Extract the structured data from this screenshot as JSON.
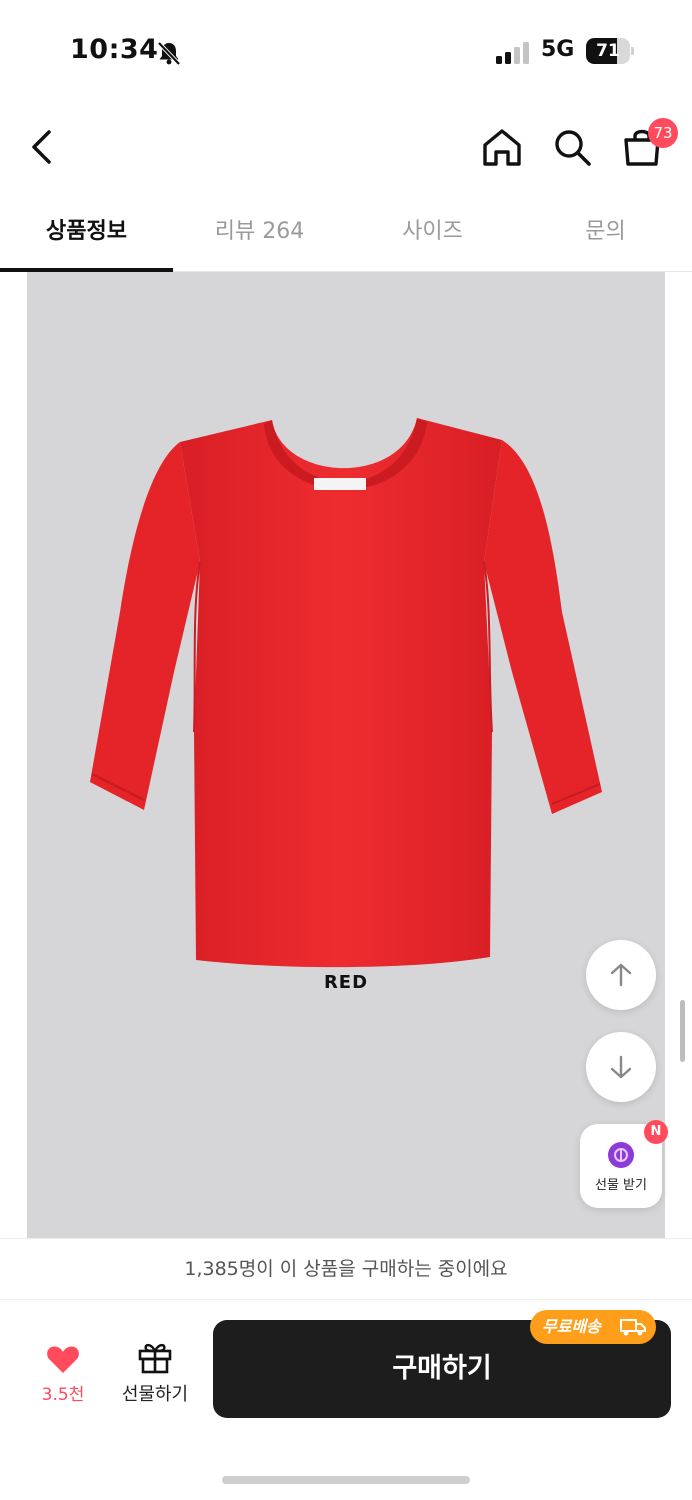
{
  "status_bar": {
    "time": "10:34",
    "network": "5G",
    "battery": "71",
    "battery_level": 0.71
  },
  "nav": {
    "back_icon": "chevron-left-icon",
    "home_icon": "home-icon",
    "search_icon": "search-icon",
    "cart_icon": "shopping-bag-icon",
    "cart_count": "73"
  },
  "tabs": [
    {
      "label": "상품정보",
      "active": true
    },
    {
      "label": "리뷰 264",
      "active": false
    },
    {
      "label": "사이즈",
      "active": false
    },
    {
      "label": "문의",
      "active": false
    }
  ],
  "product": {
    "color_label": "RED",
    "shirt_color": "#ec2a2e",
    "background": "#d6d6d9"
  },
  "floating": {
    "gift_receive_label": "선물 받기",
    "new_badge": "N"
  },
  "banner": {
    "text": "1,385명이 이 상품을 구매하는 중이에요"
  },
  "bottom_bar": {
    "like_count": "3.5천",
    "gift_label": "선물하기",
    "buy_label": "구매하기",
    "free_shipping": "무료배송"
  },
  "colors": {
    "accent_red": "#ff4b5c",
    "buy_button": "#1d1d1d",
    "free_ship_orange": "#ff9e1b"
  }
}
